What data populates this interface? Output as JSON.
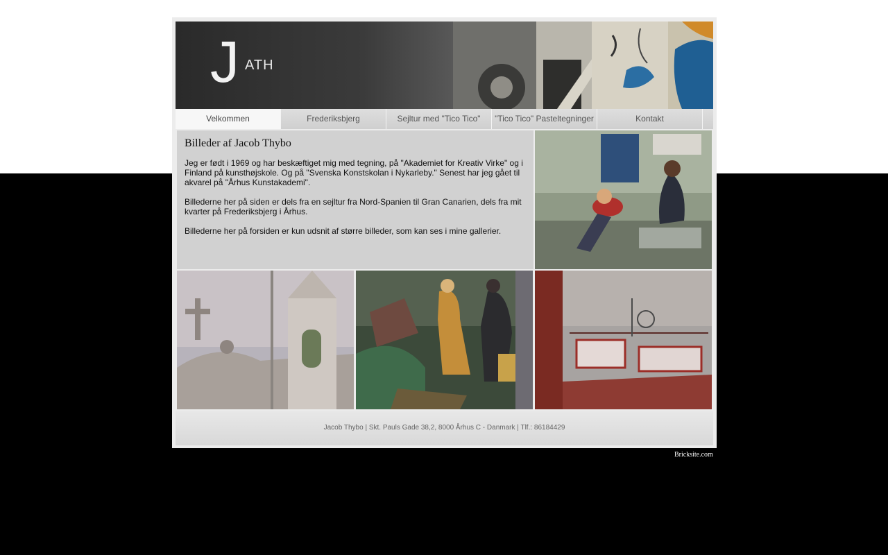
{
  "header": {
    "logo_letter": "J",
    "logo_text": "ATH"
  },
  "nav": {
    "items": [
      {
        "label": "Velkommen",
        "active": true
      },
      {
        "label": "Frederiksbjerg"
      },
      {
        "label": "Sejltur med \"Tico Tico\""
      },
      {
        "label": "\"Tico Tico\" Pasteltegninger"
      },
      {
        "label": "Kontakt"
      }
    ]
  },
  "intro": {
    "title": "Billeder af Jacob Thybo",
    "paragraphs": [
      "Jeg er født i 1969 og har beskæftiget mig med tegning, på \"Akademiet for  Kreativ Virke\" og i Finland på kunsthøjskole. Og på \"Svenska Konstskolan i Nykarleby.\" Senest har jeg gået til akvarel på \"Århus Kunstakademi\".",
      "Billederne her på siden er dels fra en sejltur fra Nord-Spanien til Gran Canarien, dels fra mit kvarter på Frederiksbjerg i Århus.",
      "Billederne her på forsiden er kun udsnit af større billeder, som kan ses i mine gallerier."
    ]
  },
  "footer": {
    "text": "Jacob Thybo | Skt. Pauls Gade 38,2, 8000 Århus C - Danmark | Tlf.: 86184429"
  },
  "credit": {
    "link_text": "Bricksite.com"
  }
}
